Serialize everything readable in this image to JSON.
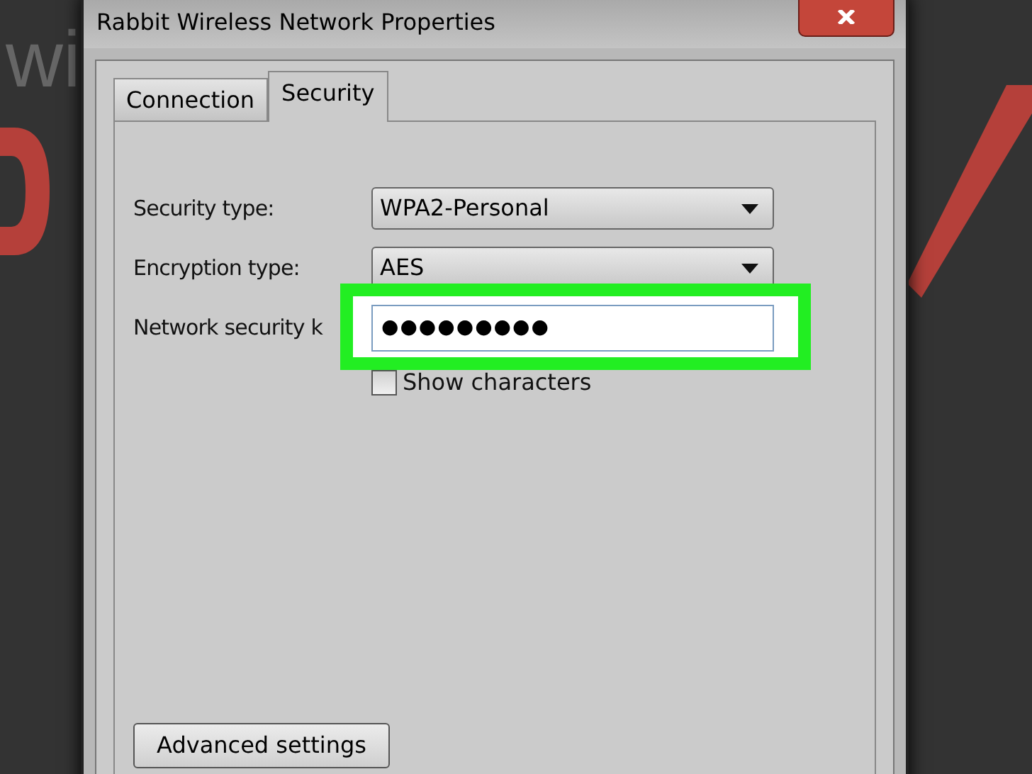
{
  "background": {
    "text": "wi"
  },
  "window": {
    "title": "Rabbit Wireless Network Properties"
  },
  "tabs": [
    {
      "label": "Connection",
      "selected": false
    },
    {
      "label": "Security",
      "selected": true
    }
  ],
  "fields": [
    {
      "kind": "dropdown",
      "label": "Security type:",
      "value": "WPA2-Personal"
    },
    {
      "kind": "dropdown",
      "label": "Encryption type:",
      "value": "AES"
    },
    {
      "kind": "password",
      "label": "Network security k",
      "value": "●●●●●●●●●",
      "highlighted": true
    }
  ],
  "show_characters": {
    "label": "Show characters",
    "checked": false
  },
  "buttons": [
    {
      "label": "Advanced settings"
    }
  ]
}
